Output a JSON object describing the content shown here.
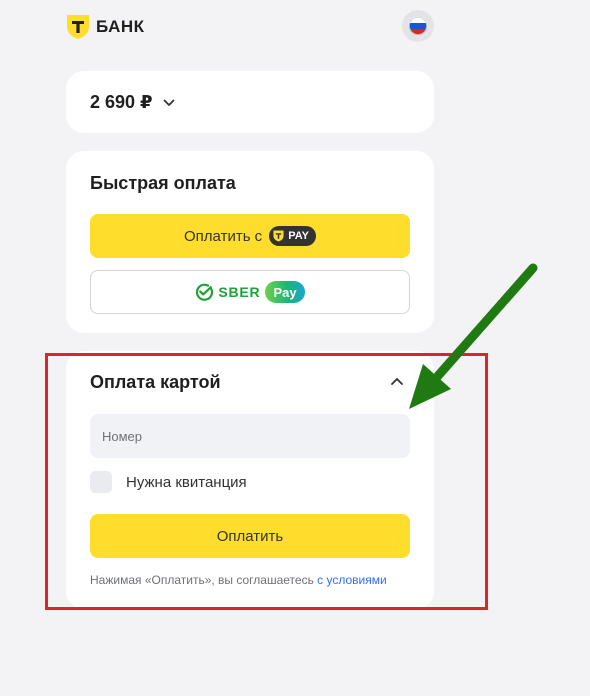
{
  "header": {
    "logo_text": "БАНК",
    "logo_icon": "shield-t-icon",
    "language_icon": "russian-flag-icon"
  },
  "amount": {
    "value": "2 690 ₽",
    "toggle_icon": "chevron-down-icon"
  },
  "fast_payment": {
    "title": "Быстрая оплата",
    "tpay_button_label": "Оплатить с",
    "tpay_badge": "PAY",
    "sber_text": "SBER",
    "sber_pay_pill": "Pay"
  },
  "card_payment": {
    "title": "Оплата картой",
    "collapse_icon": "chevron-up-icon",
    "number_placeholder": "Номер",
    "receipt_label": "Нужна квитанция",
    "pay_button_label": "Оплатить",
    "terms_text": "Нажимая «Оплатить», вы соглашаетесь ",
    "terms_link": "с условиями"
  },
  "annotations": {
    "highlight_box_color": "#d9262c",
    "arrow_color": "#1f7a12"
  },
  "colors": {
    "brand_yellow": "#ffdd2d",
    "link_blue": "#336fee",
    "sber_green": "#21a038"
  }
}
